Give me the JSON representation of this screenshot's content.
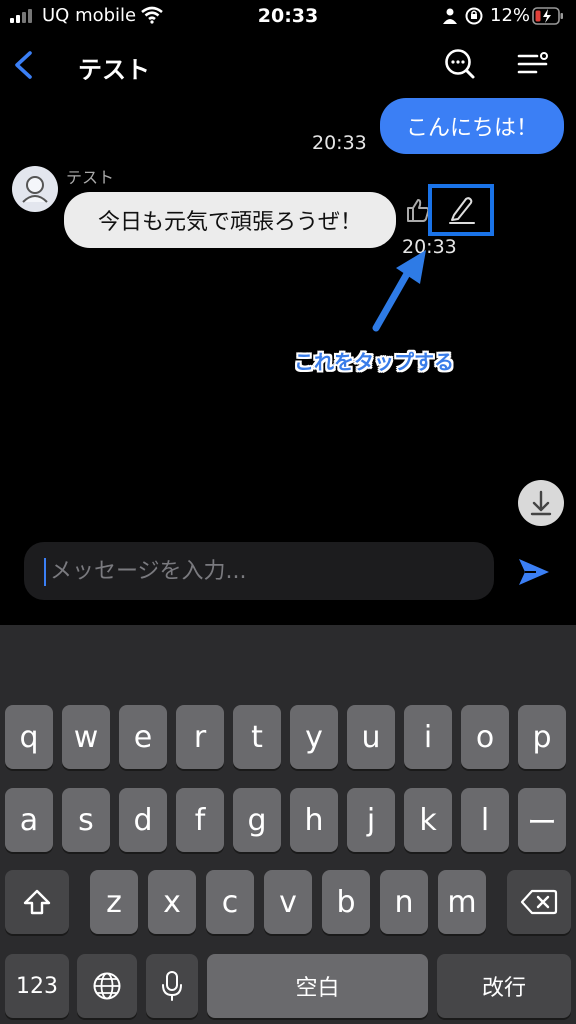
{
  "status_bar": {
    "carrier": "UQ mobile",
    "time": "20:33",
    "battery": "12%"
  },
  "header": {
    "title": "テスト"
  },
  "messages": {
    "outgoing": {
      "text": "こんにちは！",
      "time": "20:33"
    },
    "incoming": {
      "sender": "テスト",
      "text": "今日も元気で頑張ろうぜ！",
      "time": "20:33"
    }
  },
  "annotation": {
    "text": "これをタップする"
  },
  "composer": {
    "placeholder": "メッセージを入力..."
  },
  "keyboard": {
    "row1": [
      "q",
      "w",
      "e",
      "r",
      "t",
      "y",
      "u",
      "i",
      "o",
      "p"
    ],
    "row2": [
      "a",
      "s",
      "d",
      "f",
      "g",
      "h",
      "j",
      "k",
      "l",
      "ー"
    ],
    "row3": [
      "z",
      "x",
      "c",
      "v",
      "b",
      "n",
      "m"
    ],
    "numbers_key": "123",
    "space_label": "空白",
    "return_label": "改行"
  },
  "colors": {
    "accent": "#3b7ff5",
    "highlight": "#1a73e8",
    "battery_low": "#e0403a"
  }
}
